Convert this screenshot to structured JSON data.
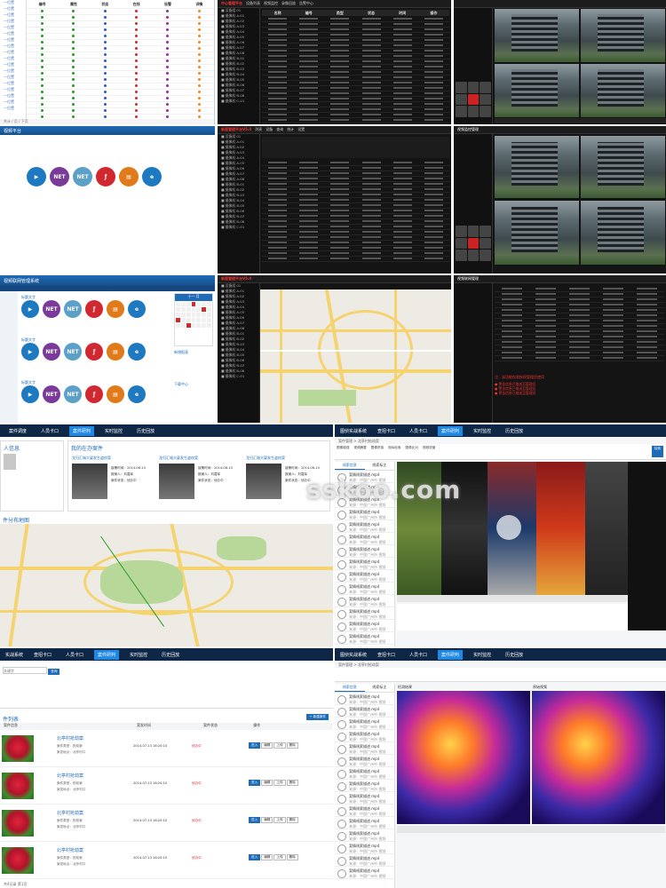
{
  "p1": {
    "rows": [
      "一位置",
      "一位置",
      "一位置",
      "一位置",
      "一位置",
      "一位置",
      "一位置",
      "一位置",
      "一位置",
      "一位置",
      "一位置",
      "一位置",
      "一位置",
      "一位置",
      "一位置",
      "一位置",
      "一位置",
      "一位置"
    ],
    "col_headers": [
      "编号",
      "属性",
      "状态",
      "在线",
      "告警",
      "详情"
    ],
    "footer": "共计 / 页 / 下页"
  },
  "p2": {
    "title": "中心管理平台",
    "tabs": [
      "设备列表",
      "视频监控",
      "录像回放",
      "告警中心"
    ],
    "side_items": [
      "■ 设备组 01",
      "■ 摄像机 A-01",
      "■ 摄像机 A-02",
      "■ 摄像机 A-03",
      "■ 摄像机 A-04",
      "■ 摄像机 A-05",
      "■ 摄像机 A-06",
      "■ 摄像机 A-07",
      "■ 摄像机 A-08",
      "■ 摄像机 B-01",
      "■ 摄像机 B-02",
      "■ 摄像机 B-03",
      "■ 摄像机 B-04",
      "■ 摄像机 B-05",
      "■ 摄像机 B-06",
      "■ 摄像机 B-07",
      "■ 摄像机 B-08",
      "■ 摄像机 C-01"
    ],
    "grid_headers": [
      "名称",
      "编号",
      "类型",
      "状态",
      "时间",
      "操作"
    ]
  },
  "p4": {
    "title": "视频平台",
    "icon_labels": [
      "▶",
      "NET",
      "NET",
      "ƒ",
      "▤",
      "e"
    ]
  },
  "p5": {
    "title": "新版管理平台V5.0",
    "tabs": [
      "列表",
      "设备",
      "查询",
      "统计",
      "设置"
    ]
  },
  "p6": {
    "title": "视频监控管理"
  },
  "p7": {
    "title": "视频联网管理系统",
    "section_labels": [
      "标题文字",
      "标题文字",
      "标题文字"
    ],
    "calendar_month": "十一 月",
    "right_panel": "新增报表",
    "right_panel2": "下载中心"
  },
  "p8": {
    "title": "新版管理平台V5.0"
  },
  "p9": {
    "title": "视频联网管理",
    "caption": "注：该功能仅限授权管理员使用",
    "notes": [
      "● 警告信息已推送至管理员",
      "● 警告信息已推送至管理员",
      "● 警告信息已推送至管理员"
    ]
  },
  "p10": {
    "nav": [
      "案件调度",
      "人员卡口",
      "案件研判",
      "实时监控",
      "历史回放"
    ],
    "section1": "人信息",
    "section2": "我的在办案件",
    "case_title": "龙归汇城大厦发生盗窃案",
    "map_title": "件分布地图",
    "info_lines": [
      "接警时间：2014-06-10",
      "报案人：刘嘉军",
      "案件状态：侦办中"
    ]
  },
  "p11": {
    "app_title": "图侦实战系统",
    "nav": [
      "查招卡口",
      "人员卡口",
      "案件研判",
      "实时监控",
      "历史回放"
    ],
    "breadcrumb": "案件管理 > 北亭村抢劫案",
    "tabs": [
      "线索信息",
      "线索标注"
    ],
    "tools": [
      "图像增强",
      "视频摘要",
      "图像拼接",
      "相似检索",
      "图像比对",
      "视频浓缩"
    ],
    "list_item": "案情线索描述.mp4",
    "list_sub": "来源：中国广州市 视频",
    "btn_search": "检索"
  },
  "p12": {
    "app_title": "实战系统",
    "nav": [
      "查招卡口",
      "人员卡口",
      "案件研判",
      "实时监控",
      "历史回放"
    ],
    "search_placeholder": "关键字",
    "search_btn": "查询",
    "list_title": "件列表",
    "add_btn": "+ 新建案件",
    "col_headers": [
      "案件信息",
      "案发时间",
      "案件状态",
      "操作"
    ],
    "case_name": "北亭村抢劫案",
    "case_lines": [
      "案件类型：抢劫案",
      "案发地点：北亭村口"
    ],
    "case_time": "2014-07-13  16:20:10",
    "case_status": "侦办中",
    "actions": [
      "进入",
      "编辑",
      "上传",
      "删除"
    ],
    "footer": "共4记录 第1页"
  },
  "p13": {
    "app_title": "图侦实战系统",
    "nav": [
      "查招卡口",
      "人员卡口",
      "案件研判",
      "实时监控",
      "历史回放"
    ],
    "breadcrumb": "案件管理 > 北亭村抢劫案",
    "tabs": [
      "线索信息",
      "线索标注"
    ],
    "left_title": "检测结果",
    "right_title": "原始视频",
    "list_item": "案情线索描述.mp4",
    "list_sub": "来源：中国广州市 视频"
  },
  "watermark": "sskoo.com",
  "colors": {
    "accent": "#1e6bb8",
    "navy": "#0f2746",
    "red": "#d0282e",
    "dark": "#141414"
  }
}
